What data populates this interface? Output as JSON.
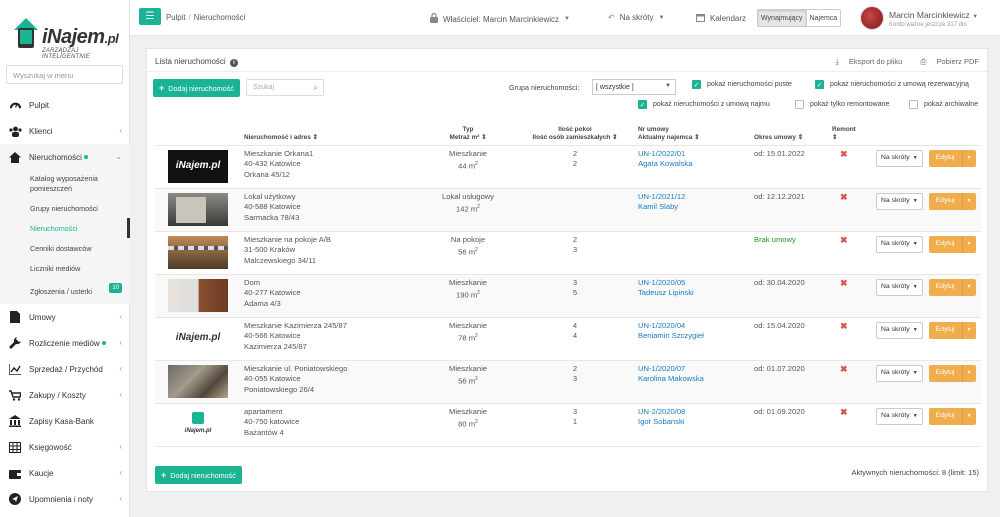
{
  "logo": {
    "brand": "iNajem",
    "tld": ".pl",
    "tagline": "ZARZĄDZAJ INTELIGENTNIE"
  },
  "sidebar": {
    "search_placeholder": "Wyszukaj w menu",
    "items": [
      {
        "label": "Pulpit",
        "icon": "dashboard-icon"
      },
      {
        "label": "Klienci",
        "icon": "users-icon"
      },
      {
        "label": "Nieruchomości",
        "icon": "home-icon"
      },
      {
        "label": "Umowy",
        "icon": "document-icon"
      },
      {
        "label": "Rozliczenie mediów",
        "icon": "wrench-icon"
      },
      {
        "label": "Sprzedaż / Przychód",
        "icon": "chart-icon"
      },
      {
        "label": "Zakupy / Koszty",
        "icon": "cart-icon"
      },
      {
        "label": "Zapisy Kasa-Bank",
        "icon": "bank-icon"
      },
      {
        "label": "Księgowość",
        "icon": "table-icon"
      },
      {
        "label": "Kaucje",
        "icon": "wallet-icon"
      },
      {
        "label": "Upomnienia i noty",
        "icon": "send-icon"
      }
    ],
    "submenu": [
      {
        "label": "Katalog wyposażenia pomieszczeń"
      },
      {
        "label": "Grupy nieruchomości"
      },
      {
        "label": "Nieruchomości"
      },
      {
        "label": "Cenniki dostawców"
      },
      {
        "label": "Liczniki mediów"
      },
      {
        "label": "Zgłoszenia / usterki",
        "badge": "10"
      }
    ]
  },
  "topbar": {
    "breadcrumb": [
      "Pulpit",
      "Nieruchomości"
    ],
    "owner": "Właściciel: Marcin Marcinkiewicz",
    "shortcuts": "Na skróty",
    "calendar": "Kalendarz",
    "mode_on": "Wynajmujący",
    "mode_off": "Najemca",
    "user_name": "Marcin Marcinkiewicz",
    "user_sub": "Konto ważne jeszcze 317 dni"
  },
  "panel": {
    "title": "Lista nieruchomości",
    "export_file": "Eksport do pliku",
    "export_pdf": "Pobierz PDF",
    "add_button": "Dodaj nieruchomość",
    "search_placeholder": "Szukaj",
    "group_label": "Grupa nieruchomości:",
    "group_value": "[ wszystkie ]",
    "filters": {
      "empty": "pokaż nieruchomości puste",
      "reserved": "pokaż nieruchomości z umową rezerwacyjną",
      "rented": "pokaż nieruchomości z umową najmu",
      "renovated": "pokaż tylko remontowane",
      "archived": "pokaż archiwalne"
    },
    "footer_info": "Aktywnych nieruchomości: 8 (limit: 15)"
  },
  "table": {
    "headers": {
      "address": "Nieruchomość i adres",
      "type_1": "Typ",
      "type_2": "Metraż m²",
      "rooms_1": "Ilość pokoi",
      "rooms_2": "Ilość osób zamieszkałych",
      "contract_1": "Nr umowy",
      "contract_2": "Aktualny najemca",
      "period": "Okres umowy",
      "repair": "Remont"
    },
    "shortcut_label": "Na skróty",
    "edit_label": "Edytuj",
    "rows": [
      {
        "name": "Mieszkanie Orkana1",
        "city": "40-432 Katowice",
        "street": "Orkana 45/12",
        "type": "Mieszkanie",
        "area": "44 m",
        "rooms": "2",
        "people": "2",
        "contract": "UN-1/2022/01",
        "tenant": "Agata Kowalska",
        "period": "od: 15.01.2022"
      },
      {
        "name": "Lokal użytkowy",
        "city": "40-588 Katowice",
        "street": "Sarmacka 78/43",
        "type": "Lokal usługowy",
        "area": "142 m",
        "rooms": "",
        "people": "",
        "contract": "UN-1/2021/12",
        "tenant": "Kamil Slaby",
        "period": "od: 12.12.2021"
      },
      {
        "name": "Mieszkanie na pokoje A/B",
        "city": "31-500 Kraków",
        "street": "Malczewskiego 34/11",
        "type": "Na pokoje",
        "area": "56 m",
        "rooms": "2",
        "people": "3",
        "contract": "",
        "tenant": "",
        "period": "Brak umowy"
      },
      {
        "name": "Dom",
        "city": "40-277 Katowice",
        "street": "Adama 4/3",
        "type": "Mieszkanie",
        "area": "190 m",
        "rooms": "3",
        "people": "5",
        "contract": "UN-1/2020/05",
        "tenant": "Tadeusz Lipinski",
        "period": "od: 30.04.2020"
      },
      {
        "name": "Mieszkanie Kazimierza 245/87",
        "city": "40-566 Katowice",
        "street": "Kazimierza 245/87",
        "type": "Mieszkanie",
        "area": "78 m",
        "rooms": "4",
        "people": "4",
        "contract": "UN-1/2020/04",
        "tenant": "Beniamin Szczygieł",
        "period": "od: 15.04.2020"
      },
      {
        "name": "Mieszkanie ul. Poniatowskiego",
        "city": "40-055 Katowice",
        "street": "Poniatowskiego 26/4",
        "type": "Mieszkanie",
        "area": "56 m",
        "rooms": "2",
        "people": "3",
        "contract": "UN-1/2020/07",
        "tenant": "Karolina Makowska",
        "period": "od: 01.07.2020"
      },
      {
        "name": "apartament",
        "city": "40-750 katowice",
        "street": "Bażantów 4",
        "type": "Mieszkanie",
        "area": "80 m",
        "rooms": "3",
        "people": "1",
        "contract": "UN-2/2020/08",
        "tenant": "Igor Sobanski",
        "period": "od: 01.09.2020"
      }
    ]
  },
  "colors": {
    "accent": "#1ab394",
    "link": "#1a7bbf",
    "edit": "#f0ad4e",
    "danger": "#d9534f"
  }
}
